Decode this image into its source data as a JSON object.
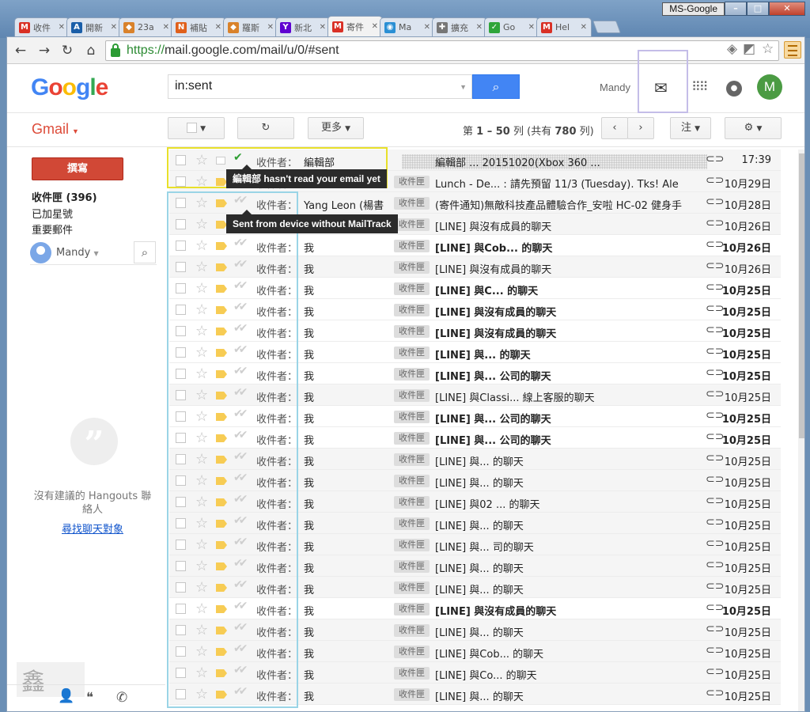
{
  "window": {
    "profile": "MS-Google",
    "minimize": "–",
    "maximize": "□",
    "close": "✕"
  },
  "tabs": [
    {
      "label": "收件",
      "icon": "M",
      "color": "#d93025",
      "active": false
    },
    {
      "label": "開新",
      "icon": "A",
      "color": "#1a5ea8",
      "active": false
    },
    {
      "label": "23a",
      "icon": "◆",
      "color": "#d9822b",
      "active": false
    },
    {
      "label": "補貼",
      "icon": "N",
      "color": "#e0601b",
      "active": false
    },
    {
      "label": "羅斯",
      "icon": "◆",
      "color": "#d9822b",
      "active": false
    },
    {
      "label": "新北",
      "icon": "Y",
      "color": "#5f01d1",
      "active": false
    },
    {
      "label": "寄件",
      "icon": "M",
      "color": "#d93025",
      "active": true
    },
    {
      "label": "Ma",
      "icon": "◉",
      "color": "#2a8fd4",
      "active": false
    },
    {
      "label": "擴充",
      "icon": "✚",
      "color": "#777777",
      "active": false
    },
    {
      "label": "Go",
      "icon": "✓",
      "color": "#2ea53a",
      "active": false
    },
    {
      "label": "Hel",
      "icon": "M",
      "color": "#d93025",
      "active": false
    }
  ],
  "address": {
    "scheme": "https://",
    "host": "mail.google.com",
    "path": "/mail/u/0/#sent"
  },
  "header": {
    "logo": "Google",
    "search_value": "in:sent",
    "user": "Mandy",
    "avatar_letter": "M"
  },
  "subbar": {
    "gmail": "Gmail",
    "more": "更多",
    "pager_prefix": "第",
    "pager_range": "1 – 50",
    "pager_mid": "列 (共有",
    "pager_total": "780",
    "pager_suffix": "列)",
    "note": "注"
  },
  "sidebar": {
    "compose": "撰寫",
    "nav": [
      {
        "label": "收件匣 (396)",
        "bold": true
      },
      {
        "label": "已加星號",
        "bold": false
      },
      {
        "label": "重要郵件",
        "bold": false
      }
    ],
    "hangouts_user": "Mandy",
    "hangouts_empty": "沒有建議的 Hangouts 聯絡人",
    "hangouts_link": "尋找聊天對象"
  },
  "tooltips": {
    "unread": "編輯部 hasn't read your email yet",
    "nomt": "Sent from device without MailTrack"
  },
  "emails": [
    {
      "to": "編輯部",
      "label": "",
      "subject": "編輯部 ... 20151020(Xbox 360 ...",
      "date": "17:39",
      "unread": false,
      "tick": "green",
      "imp": false,
      "blurFull": true
    },
    {
      "to": "",
      "label": "收件匣",
      "subject": "Lunch - De... : 請先預留 11/3 (Tuesday). Tks! Ale",
      "date": "10月29日",
      "unread": false,
      "tick": "",
      "imp": true
    },
    {
      "to": "Yang Leon (楊書",
      "label": "收件匣",
      "subject": "(寄件通知)無敵科技產品體驗合作_安啦 HC-02 健身手",
      "date": "10月28日",
      "unread": false,
      "tick": "",
      "imp": true
    },
    {
      "to": "",
      "label": "收件匣",
      "subject": "[LINE] 與沒有成員的聊天",
      "date": "10月26日",
      "unread": false,
      "tick": "",
      "imp": true
    },
    {
      "to": "我",
      "label": "收件匣",
      "subject": "[LINE] 與Cob... 的聊天",
      "date": "10月26日",
      "unread": true,
      "imp": true
    },
    {
      "to": "我",
      "label": "收件匣",
      "subject": "[LINE] 與沒有成員的聊天",
      "date": "10月26日",
      "unread": false,
      "imp": true
    },
    {
      "to": "我",
      "label": "收件匣",
      "subject": "[LINE] 與C... 的聊天",
      "date": "10月25日",
      "unread": true,
      "imp": true
    },
    {
      "to": "我",
      "label": "收件匣",
      "subject": "[LINE] 與沒有成員的聊天",
      "date": "10月25日",
      "unread": true,
      "imp": true
    },
    {
      "to": "我",
      "label": "收件匣",
      "subject": "[LINE] 與沒有成員的聊天",
      "date": "10月25日",
      "unread": true,
      "imp": true
    },
    {
      "to": "我",
      "label": "收件匣",
      "subject": "[LINE] 與... 的聊天",
      "date": "10月25日",
      "unread": true,
      "imp": true
    },
    {
      "to": "我",
      "label": "收件匣",
      "subject": "[LINE] 與... 公司的聊天",
      "date": "10月25日",
      "unread": true,
      "imp": true
    },
    {
      "to": "我",
      "label": "收件匣",
      "subject": "[LINE] 與Classi... 線上客服的聊天",
      "date": "10月25日",
      "unread": false,
      "imp": true
    },
    {
      "to": "我",
      "label": "收件匣",
      "subject": "[LINE] 與... 公司的聊天",
      "date": "10月25日",
      "unread": true,
      "imp": true
    },
    {
      "to": "我",
      "label": "收件匣",
      "subject": "[LINE] 與... 公司的聊天",
      "date": "10月25日",
      "unread": true,
      "imp": true
    },
    {
      "to": "我",
      "label": "收件匣",
      "subject": "[LINE] 與... 的聊天",
      "date": "10月25日",
      "unread": false,
      "imp": true
    },
    {
      "to": "我",
      "label": "收件匣",
      "subject": "[LINE] 與... 的聊天",
      "date": "10月25日",
      "unread": false,
      "imp": true
    },
    {
      "to": "我",
      "label": "收件匣",
      "subject": "[LINE] 與02 ... 的聊天",
      "date": "10月25日",
      "unread": false,
      "imp": true
    },
    {
      "to": "我",
      "label": "收件匣",
      "subject": "[LINE] 與... 的聊天",
      "date": "10月25日",
      "unread": false,
      "imp": true
    },
    {
      "to": "我",
      "label": "收件匣",
      "subject": "[LINE] 與... 司的聊天",
      "date": "10月25日",
      "unread": false,
      "imp": true
    },
    {
      "to": "我",
      "label": "收件匣",
      "subject": "[LINE] 與... 的聊天",
      "date": "10月25日",
      "unread": false,
      "imp": true
    },
    {
      "to": "我",
      "label": "收件匣",
      "subject": "[LINE] 與... 的聊天",
      "date": "10月25日",
      "unread": false,
      "imp": true
    },
    {
      "to": "我",
      "label": "收件匣",
      "subject": "[LINE] 與沒有成員的聊天",
      "date": "10月25日",
      "unread": true,
      "imp": true
    },
    {
      "to": "我",
      "label": "收件匣",
      "subject": "[LINE] 與... 的聊天",
      "date": "10月25日",
      "unread": false,
      "imp": true
    },
    {
      "to": "我",
      "label": "收件匣",
      "subject": "[LINE] 與Cob... 的聊天",
      "date": "10月25日",
      "unread": false,
      "imp": true
    },
    {
      "to": "我",
      "label": "收件匣",
      "subject": "[LINE] 與Co... 的聊天",
      "date": "10月25日",
      "unread": false,
      "imp": true
    },
    {
      "to": "我",
      "label": "收件匣",
      "subject": "[LINE] 與... 的聊天",
      "date": "10月25日",
      "unread": false,
      "imp": true
    }
  ],
  "row_prefix": "收件者："
}
